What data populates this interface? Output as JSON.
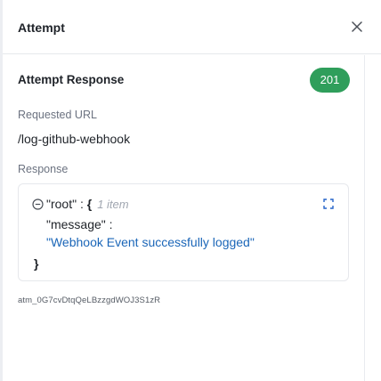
{
  "header": {
    "title": "Attempt",
    "close_icon": "close-icon"
  },
  "response_section": {
    "title": "Attempt Response",
    "status_code": "201",
    "status_color": "#2f9e5b"
  },
  "requested_url": {
    "label": "Requested URL",
    "value": "/log-github-webhook"
  },
  "response": {
    "label": "Response",
    "json": {
      "root_key": "\"root\"",
      "root_separator": " : ",
      "open_brace": "{",
      "item_count": "1 item",
      "message_key": "\"message\"",
      "message_separator": " :",
      "message_value": "\"Webhook Event successfully logged\"",
      "close_brace": "}"
    },
    "expand_icon": "fullscreen-icon",
    "collapse_icon": "collapse-minus-icon"
  },
  "attempt_id": "atm_0G7cvDtqQeLBzzgdWOJ3S1zR"
}
